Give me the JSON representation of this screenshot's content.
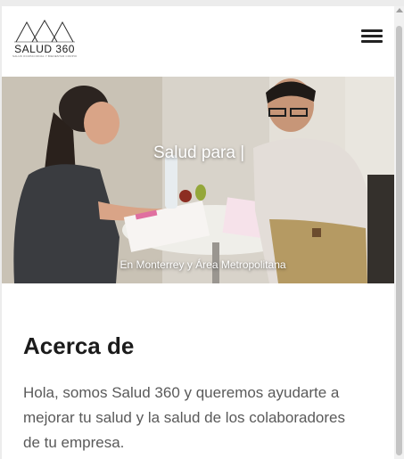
{
  "brand": {
    "name": "SALUD 360",
    "tagline": "SALUD OCUPACIONAL Y BIENESTAR CORPORATIVO"
  },
  "header": {
    "menu_icon": "hamburger-menu-icon"
  },
  "hero": {
    "title_text": "Salud para",
    "cursor": "|",
    "subtitle": "En Monterrey y Área Metropolitana"
  },
  "about": {
    "title": "Acerca de",
    "body": "Hola, somos Salud 360 y queremos ayudarte a mejorar tu salud y la salud de los colaboradores de tu empresa."
  },
  "colors": {
    "text_dark": "#1b1b1b",
    "text_body": "#5a5a5a",
    "header_bg": "#ffffff"
  }
}
